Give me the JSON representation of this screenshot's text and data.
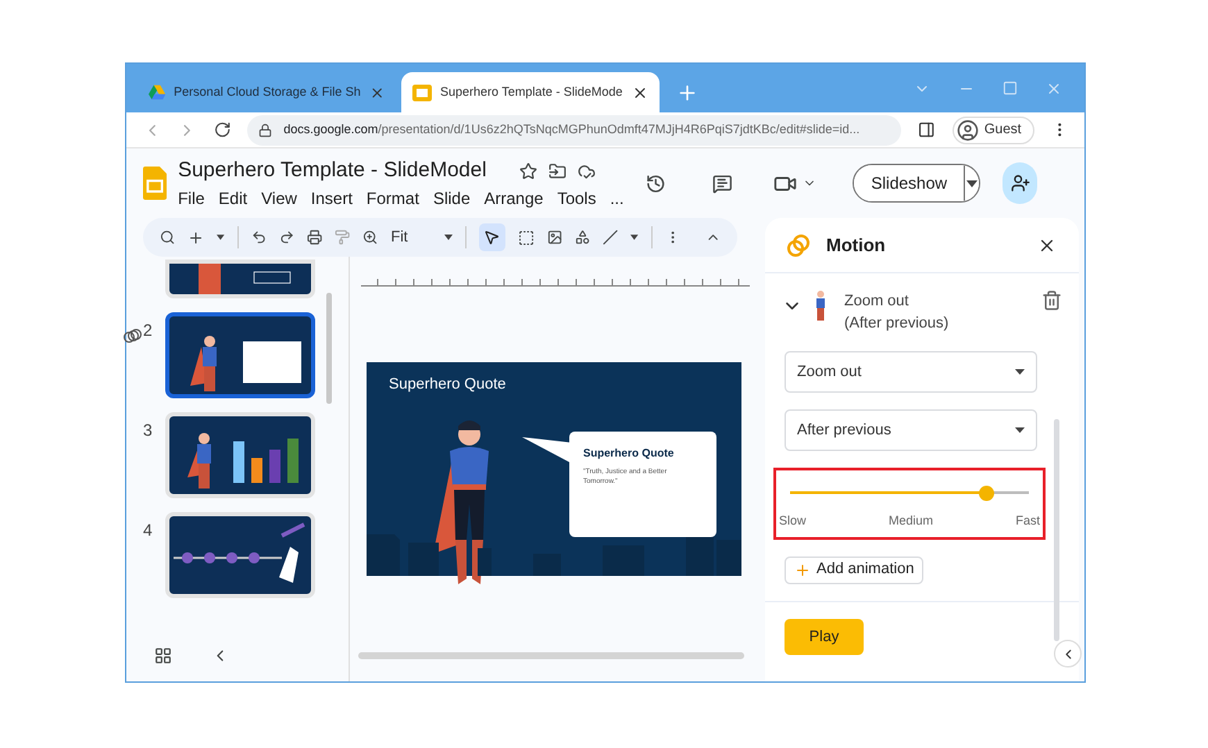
{
  "browser": {
    "tabs": [
      {
        "title": "Personal Cloud Storage & File Sh",
        "kind": "drive",
        "selected": false
      },
      {
        "title": "Superhero Template - SlideMode",
        "kind": "slides",
        "selected": true
      }
    ],
    "url_host": "docs.google.com",
    "url_path": "/presentation/d/1Us6z2hQTsNqcMGPhunOdmft47MJjH4R6PqiS7jdtKBc/edit#slide=id...",
    "profile": "Guest"
  },
  "document": {
    "title": "Superhero Template - SlideModel",
    "menus": [
      "File",
      "Edit",
      "View",
      "Insert",
      "Format",
      "Slide",
      "Arrange",
      "Tools",
      "..."
    ],
    "slideshow_button": "Slideshow"
  },
  "toolbar": {
    "zoom": "Fit"
  },
  "slides": [
    {
      "kind": "hero",
      "selected": false
    },
    {
      "number": "2",
      "kind": "quote",
      "selected": true
    },
    {
      "number": "3",
      "kind": "chart",
      "selected": false
    },
    {
      "number": "4",
      "kind": "timeline",
      "selected": false
    }
  ],
  "slide": {
    "title": "Superhero Quote",
    "quote_title": "Superhero Quote",
    "quote_text": "\"Truth, Justice and a Better Tomorrow.\""
  },
  "motion_panel": {
    "title": "Motion",
    "animation": {
      "name": "Zoom out",
      "trigger": "(After previous)",
      "expanded": true
    },
    "effect_select": "Zoom out",
    "trigger_select": "After previous",
    "speed": {
      "level": 0.82,
      "labels": [
        "Slow",
        "Medium",
        "Fast"
      ]
    },
    "add_button": "Add animation",
    "play_button": "Play"
  }
}
